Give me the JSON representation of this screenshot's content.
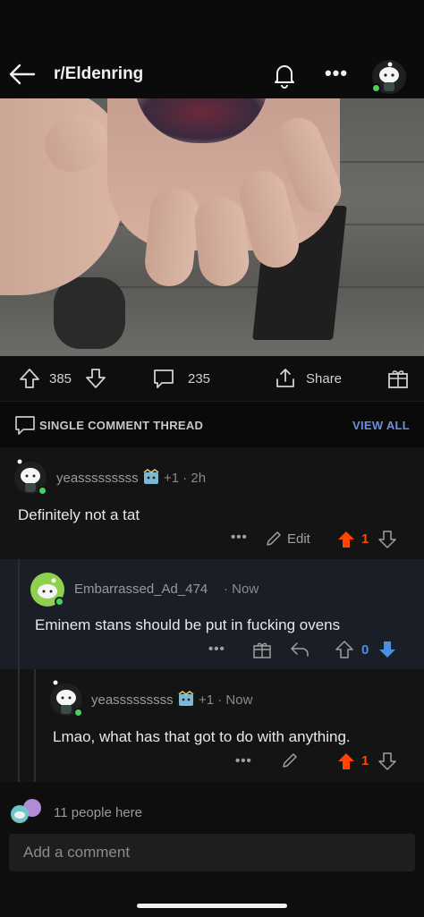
{
  "header": {
    "subreddit": "r/Eldenring",
    "icons": [
      "back-arrow-icon",
      "bell-icon",
      "more-icon",
      "avatar"
    ]
  },
  "post_actions": {
    "upvotes": "385",
    "comments": "235",
    "share_label": "Share"
  },
  "thread": {
    "label": "SINGLE COMMENT THREAD",
    "view_all": "VIEW ALL"
  },
  "comments": [
    {
      "username": "yeasssssssss",
      "flair_meta": "+1 · 2h",
      "text": "Definitely not a tat",
      "edit_label": "Edit",
      "score": "1",
      "upvoted": true
    },
    {
      "username": "Embarrassed_Ad_474",
      "flair_meta": "· Now",
      "text": "Eminem stans should be put in fucking ovens",
      "score": "0",
      "downvoted": true
    },
    {
      "username": "yeasssssssss",
      "flair_meta": "+1 · Now",
      "text": "Lmao, what has that got to do with anything.",
      "score": "1",
      "upvoted": true
    }
  ],
  "footer": {
    "people_here": "11 people here",
    "add_comment_placeholder": "Add a comment"
  },
  "colors": {
    "upvote": "#ff4500",
    "downvote": "#4a90e2",
    "link": "#6b8fe0",
    "online": "#46d160"
  }
}
